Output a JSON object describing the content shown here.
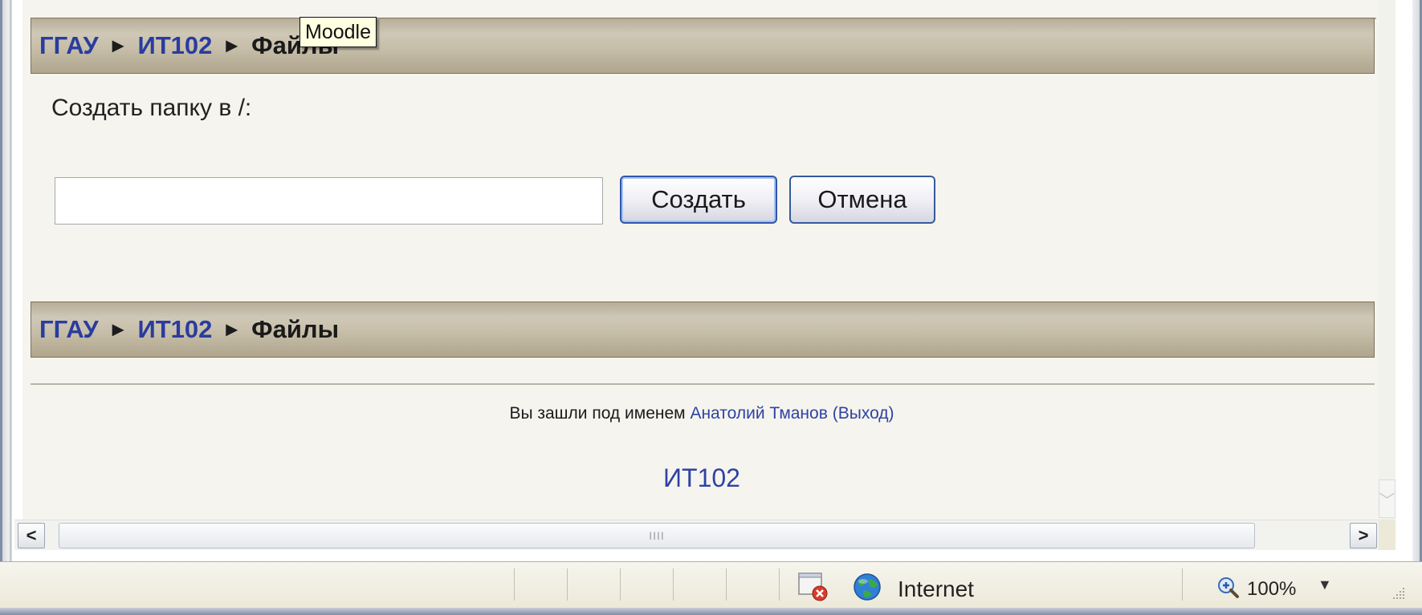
{
  "tooltip": {
    "text": "Moodle"
  },
  "breadcrumb": {
    "items": [
      {
        "label": "ГГАУ"
      },
      {
        "label": "ИТ102"
      },
      {
        "label": "Файлы"
      }
    ],
    "separator": "►"
  },
  "form": {
    "create_folder_label": "Создать папку в /:",
    "folder_name_value": "",
    "create_button": "Создать",
    "cancel_button": "Отмена"
  },
  "footer": {
    "logged_in_prefix": "Вы зашли под именем",
    "user_name": "Анатолий Тманов",
    "logout_label": "(Выход)",
    "course_link": "ИТ102"
  },
  "scrollbar": {
    "left_arrow": "<",
    "right_arrow": ">",
    "thumb_grip": "IIII",
    "down_arrow": "﹀"
  },
  "statusbar": {
    "zone": "Internet",
    "zoom": "100%",
    "zoom_dropdown_arrow": "▼"
  },
  "icons": {
    "zone_icon": "globe-icon",
    "popup_blocked_icon": "page-blocked-icon",
    "zoom_icon": "magnifier-plus-icon"
  },
  "colors": {
    "navbar": "#c4bca8",
    "link": "#2a3c9f",
    "page_background": "#f6f4ee"
  }
}
